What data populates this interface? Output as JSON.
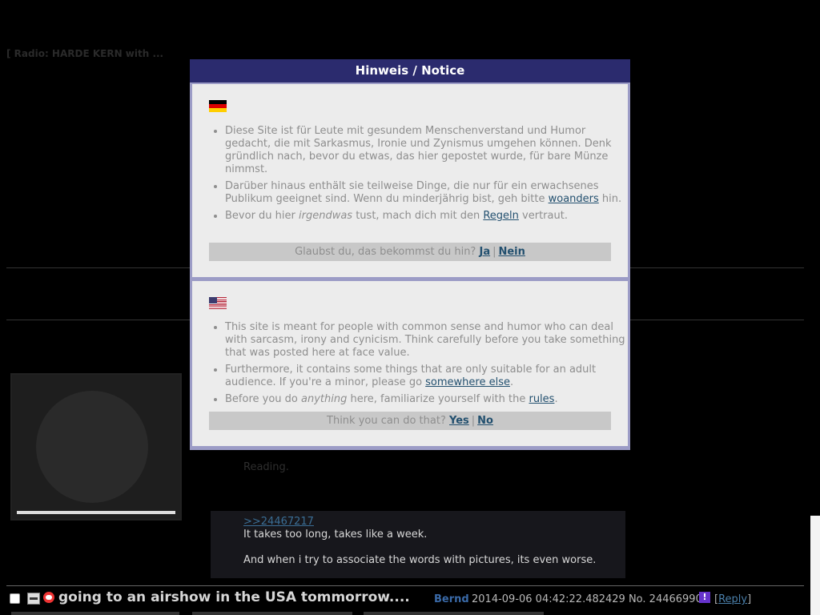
{
  "background": {
    "radio_bar": "[ Radio: HARDE KERN with ...",
    "thread": {
      "subject": "going to an airshow in the USA tommorrow....",
      "author": "Bernd",
      "date_no": "2014-09-06 04:42:22.482429 No. 24466990",
      "reply_label": "Reply"
    },
    "reply_post": {
      "heading_text": "Reading.",
      "quote_link": ">>24467217",
      "line1": "It takes too long, takes like a week.",
      "line2": "And when i try to associate the words with pictures, its even worse."
    }
  },
  "modal": {
    "title": "Hinweis / Notice",
    "de": {
      "flag": "flag-de-icon",
      "item1": "Diese Site ist für Leute mit gesundem Menschenverstand und Humor gedacht, die mit Sarkasmus, Ironie und Zynismus umgehen können. Denk gründlich nach, bevor du etwas, das hier gepostet wurde, für bare Münze nimmst.",
      "item2_pre": "Darüber hinaus enthält sie teilweise Dinge, die nur für ein erwachsenes Publikum geeignet sind. Wenn du minderjährig bist, geh bitte ",
      "item2_link": "woanders",
      "item2_post": " hin.",
      "item3_pre": "Bevor du hier ",
      "item3_em": "irgendwas",
      "item3_mid": " tust, mach dich mit den ",
      "item3_link": "Regeln",
      "item3_post": " vertraut.",
      "question": "Glaubst du, das bekommst du hin?",
      "yes": "Ja",
      "sep": "|",
      "no": "Nein"
    },
    "en": {
      "flag": "flag-us-icon",
      "item1": "This site is meant for people with common sense and humor who can deal with sarcasm, irony and cynicism. Think carefully before you take something that was posted here at face value.",
      "item2_pre": "Furthermore, it contains some things that are only suitable for an adult audience. If you're a minor, please go ",
      "item2_link": "somewhere else",
      "item2_post": ".",
      "item3_pre": "Before you do ",
      "item3_em": "anything",
      "item3_mid": " here, familiarize yourself with the ",
      "item3_link": "rules",
      "item3_post": ".",
      "question": "Think you can do that?",
      "yes": "Yes",
      "sep": "|",
      "no": "No"
    }
  }
}
